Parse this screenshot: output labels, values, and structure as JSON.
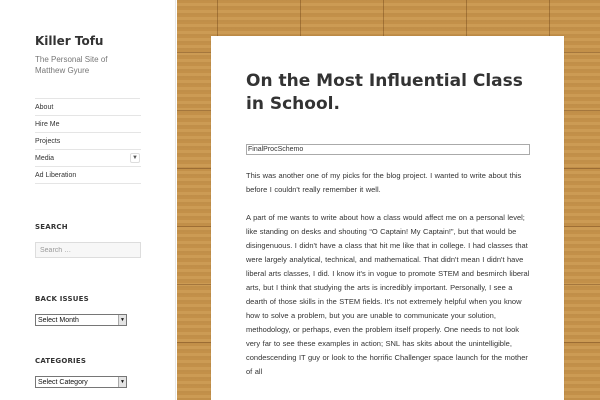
{
  "site": {
    "title": "Killer Tofu",
    "description": "The Personal Site of Matthew Gyure"
  },
  "nav": {
    "items": [
      {
        "label": "About",
        "has_submenu": false
      },
      {
        "label": "Hire Me",
        "has_submenu": false
      },
      {
        "label": "Projects",
        "has_submenu": false
      },
      {
        "label": "Media",
        "has_submenu": true,
        "icon": "chevron-down-icon"
      },
      {
        "label": "Ad Liberation",
        "has_submenu": false
      }
    ]
  },
  "widgets": {
    "search": {
      "title": "SEARCH",
      "placeholder": "Search …"
    },
    "back_issues": {
      "title": "BACK ISSUES",
      "selected": "Select Month"
    },
    "categories": {
      "title": "CATEGORIES",
      "selected": "Select Category"
    }
  },
  "post": {
    "title": "On the Most Influential Class in School.",
    "image_alt": "FinalProcSchemo",
    "paragraphs": [
      "This was another one of my picks for the blog project. I wanted to write about this before I couldn't really remember it well.",
      "A part of me wants to write about how a class would affect me on a personal level; like standing on desks and shouting “O Captain! My Captain!”, but that would be disingenuous. I didn't have a class that hit me like that in college. I had classes that were largely analytical, technical, and mathematical. That didn't mean I didn't have liberal arts classes, I did. I know it's in vogue to promote STEM and besmirch liberal arts, but I think that studying the arts is incredibly important. Personally, I see a dearth of those skills in the STEM fields. It's not extremely helpful when you know how to solve a problem, but you are unable to communicate your solution, methodology, or perhaps, even the problem itself properly. One needs to not look very far to see these examples in action; SNL has skits about the unintelligible, condescending IT guy or look to the horrific Challenger space launch for the mother of all"
    ]
  },
  "colors": {
    "wood": "#c9974f",
    "text": "#333333"
  }
}
